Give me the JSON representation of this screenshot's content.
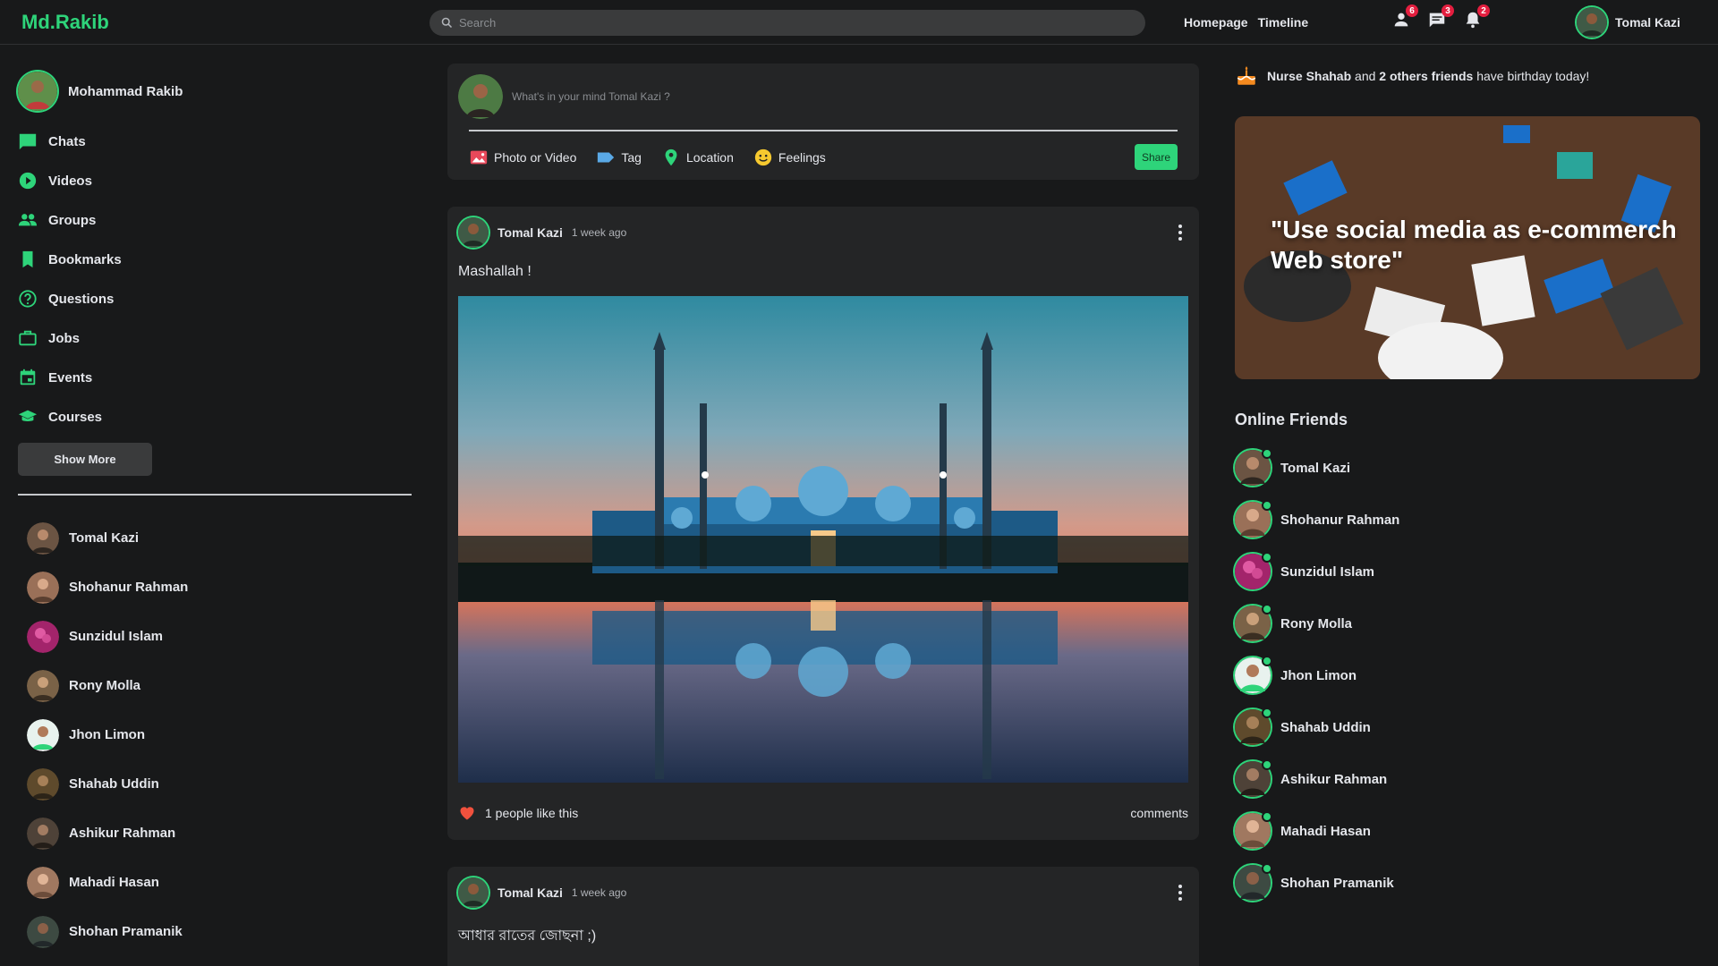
{
  "brand": {
    "logo": "Md.Rakib",
    "accent": "#2ed47a"
  },
  "search": {
    "placeholder": "Search"
  },
  "topbar": {
    "links": [
      "Homepage",
      "Timeline"
    ],
    "badges": {
      "friends": "6",
      "messages": "3",
      "notifications": "2"
    },
    "user": "Tomal Kazi"
  },
  "sidebar": {
    "profile_name": "Mohammad Rakib",
    "menu": [
      {
        "label": "Chats",
        "icon": "chat-icon"
      },
      {
        "label": "Videos",
        "icon": "play-circle-icon"
      },
      {
        "label": "Groups",
        "icon": "group-icon"
      },
      {
        "label": "Bookmarks",
        "icon": "bookmark-icon"
      },
      {
        "label": "Questions",
        "icon": "question-icon"
      },
      {
        "label": "Jobs",
        "icon": "briefcase-icon"
      },
      {
        "label": "Events",
        "icon": "calendar-icon"
      },
      {
        "label": "Courses",
        "icon": "graduation-icon"
      }
    ],
    "show_more": "Show More",
    "friends": [
      "Tomal Kazi",
      "Shohanur Rahman",
      "Sunzidul Islam",
      "Rony Molla",
      "Jhon Limon",
      "Shahab Uddin",
      "Ashikur Rahman",
      "Mahadi Hasan",
      "Shohan Pramanik"
    ]
  },
  "composer": {
    "placeholder": "What's in your mind Tomal Kazi ?",
    "actions": [
      "Photo or Video",
      "Tag",
      "Location",
      "Feelings"
    ],
    "share": "Share"
  },
  "posts": [
    {
      "author": "Tomal Kazi",
      "time": "1 week ago",
      "text": "Mashallah !",
      "likes": "1 people like this",
      "comments": "comments"
    },
    {
      "author": "Tomal Kazi",
      "time": "1 week ago",
      "text": "আধার রাতের জোছনা ;)"
    }
  ],
  "rightbar": {
    "birthday": {
      "name": "Nurse Shahab",
      "and": "and",
      "others": "2 others friends",
      "tail": "have birthday today!"
    },
    "ad_text": "\"Use social media as e-commerch Web store\"",
    "online_title": "Online Friends",
    "online": [
      "Tomal Kazi",
      "Shohanur Rahman",
      "Sunzidul Islam",
      "Rony Molla",
      "Jhon Limon",
      "Shahab Uddin",
      "Ashikur Rahman",
      "Mahadi Hasan",
      "Shohan Pramanik"
    ]
  }
}
